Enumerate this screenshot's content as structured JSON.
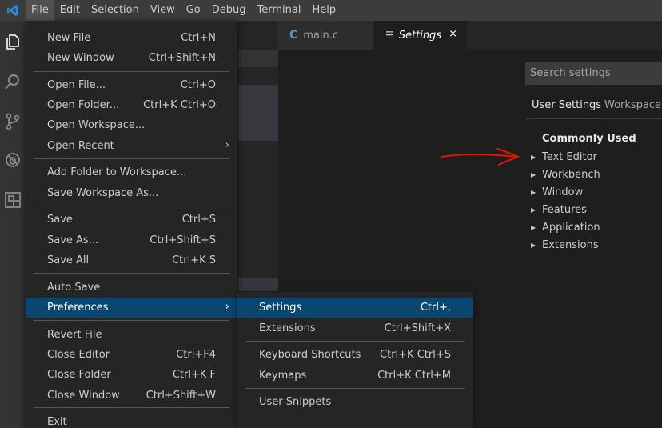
{
  "menubar": {
    "items": [
      "File",
      "Edit",
      "Selection",
      "View",
      "Go",
      "Debug",
      "Terminal",
      "Help"
    ]
  },
  "tabs": [
    {
      "label": "main.c",
      "icon": "C"
    },
    {
      "label": "Settings",
      "close": "×"
    }
  ],
  "settings": {
    "search_placeholder": "Search settings",
    "tabs": [
      "User Settings",
      "Workspace S"
    ],
    "toc_title": "Commonly Used",
    "toc_items": [
      "Text Editor",
      "Workbench",
      "Window",
      "Features",
      "Application",
      "Extensions"
    ]
  },
  "file_menu": {
    "items": [
      {
        "label": "New File",
        "shortcut": "Ctrl+N"
      },
      {
        "label": "New Window",
        "shortcut": "Ctrl+Shift+N"
      },
      {
        "label": "Open File...",
        "shortcut": "Ctrl+O"
      },
      {
        "label": "Open Folder...",
        "shortcut": "Ctrl+K Ctrl+O"
      },
      {
        "label": "Open Workspace...",
        "shortcut": ""
      },
      {
        "label": "Open Recent",
        "shortcut": ""
      },
      {
        "label": "Add Folder to Workspace...",
        "shortcut": ""
      },
      {
        "label": "Save Workspace As...",
        "shortcut": ""
      },
      {
        "label": "Save",
        "shortcut": "Ctrl+S"
      },
      {
        "label": "Save As...",
        "shortcut": "Ctrl+Shift+S"
      },
      {
        "label": "Save All",
        "shortcut": "Ctrl+K S"
      },
      {
        "label": "Auto Save",
        "shortcut": ""
      },
      {
        "label": "Preferences",
        "shortcut": ""
      },
      {
        "label": "Revert File",
        "shortcut": ""
      },
      {
        "label": "Close Editor",
        "shortcut": "Ctrl+F4"
      },
      {
        "label": "Close Folder",
        "shortcut": "Ctrl+K F"
      },
      {
        "label": "Close Window",
        "shortcut": "Ctrl+Shift+W"
      },
      {
        "label": "Exit",
        "shortcut": ""
      }
    ]
  },
  "preferences_menu": {
    "items": [
      {
        "label": "Settings",
        "shortcut": "Ctrl+,"
      },
      {
        "label": "Extensions",
        "shortcut": "Ctrl+Shift+X"
      },
      {
        "label": "Keyboard Shortcuts",
        "shortcut": "Ctrl+K Ctrl+S"
      },
      {
        "label": "Keymaps",
        "shortcut": "Ctrl+K Ctrl+M"
      },
      {
        "label": "User Snippets",
        "shortcut": ""
      }
    ]
  },
  "colors": {
    "accent": "#094771",
    "annotation": "#e51400"
  }
}
